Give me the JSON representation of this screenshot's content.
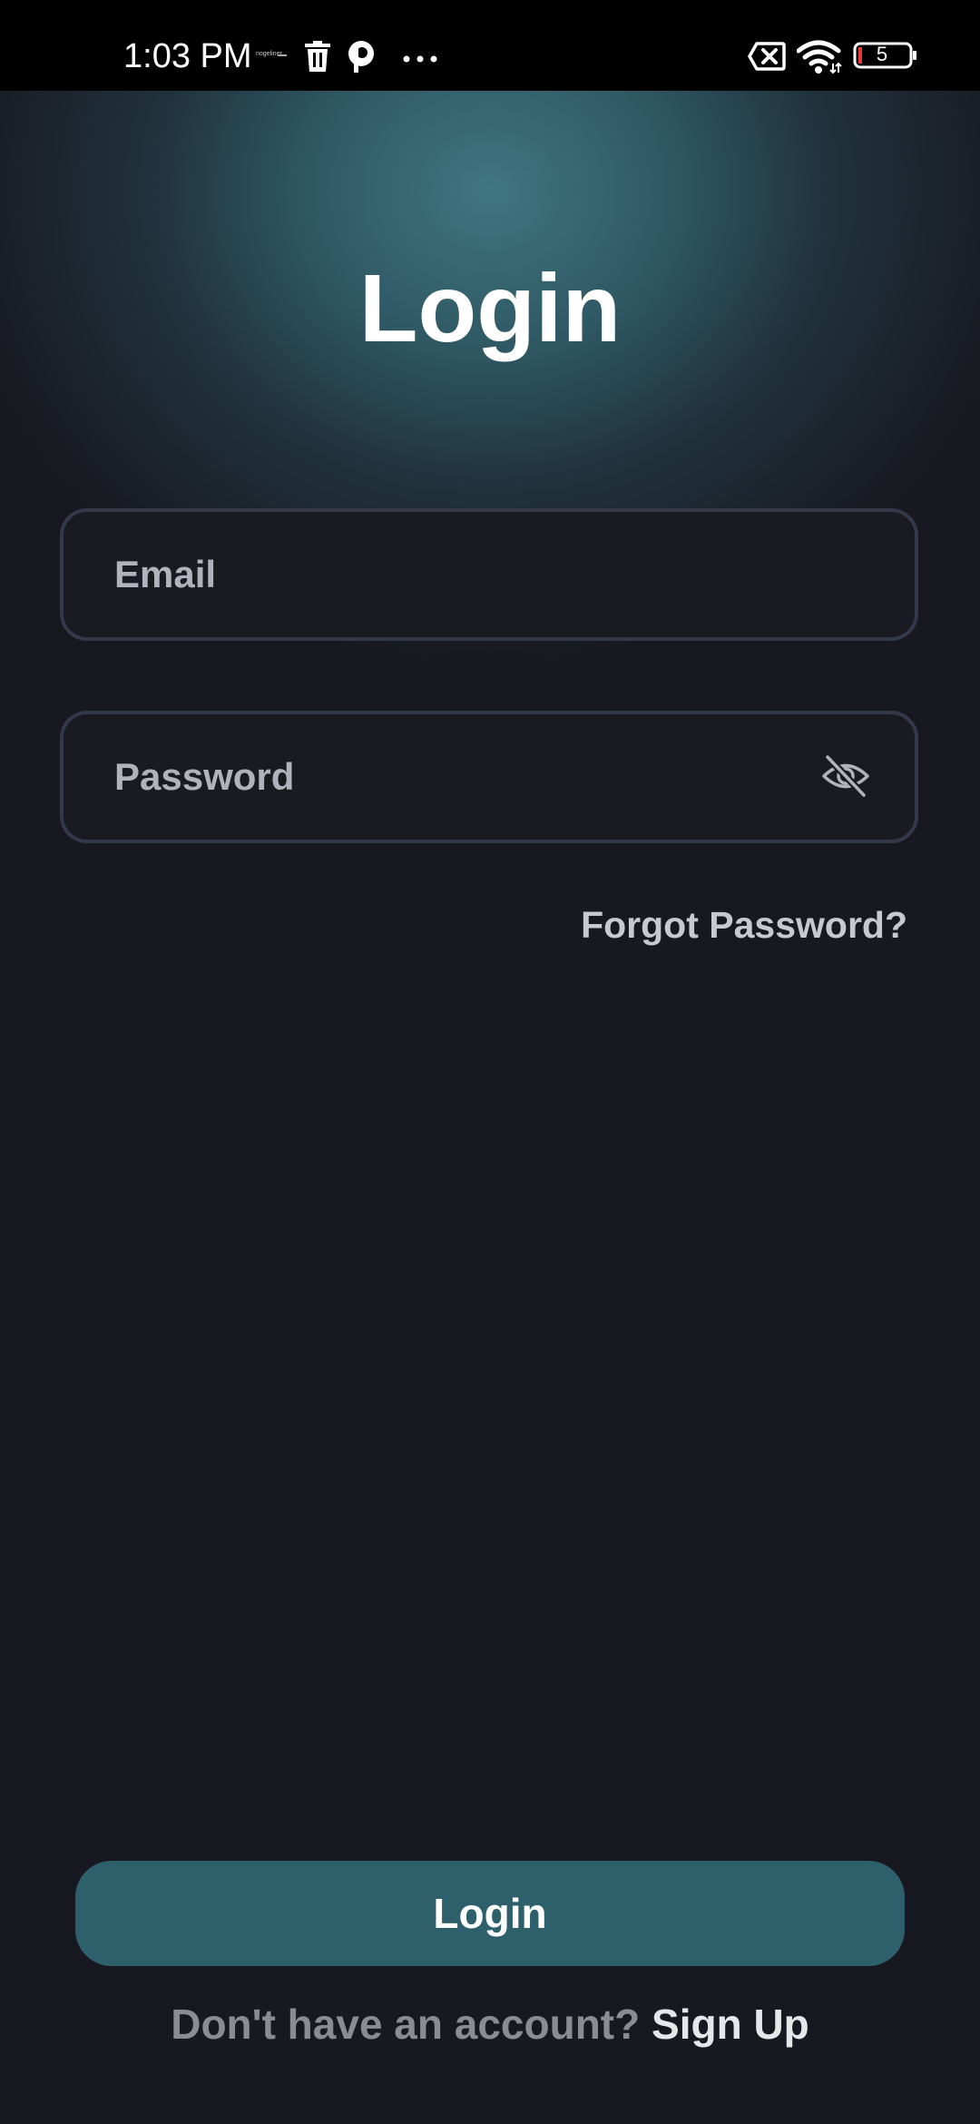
{
  "status_bar": {
    "time": "1:03 PM",
    "tiny_label": "nogeliner",
    "battery_level": "5",
    "icons": [
      "trash-icon",
      "p-app-icon",
      "more-dots-icon",
      "screen-x-icon",
      "wifi-icon",
      "battery-icon"
    ]
  },
  "login": {
    "title": "Login",
    "email": {
      "placeholder": "Email",
      "value": ""
    },
    "password": {
      "placeholder": "Password",
      "value": "",
      "toggle_icon": "eye-off-icon"
    },
    "forgot_password": "Forgot Password?",
    "login_button": "Login",
    "signup_prompt": "Don't have an account?",
    "signup_link": "Sign Up"
  },
  "colors": {
    "background": "#181820",
    "accent": "#2e606c",
    "glow": "#3f7682",
    "field_border": "#33384a"
  }
}
